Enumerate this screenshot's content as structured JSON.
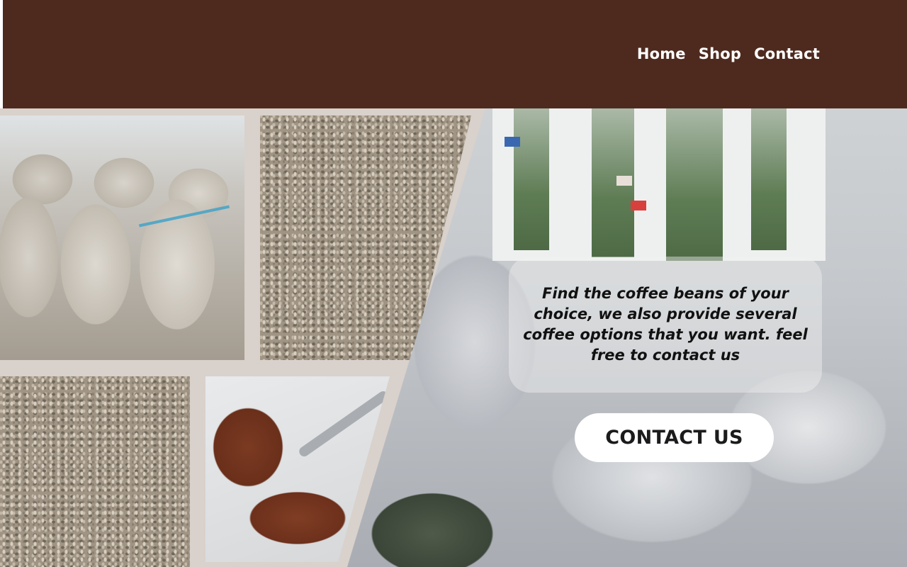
{
  "nav": {
    "home": "Home",
    "shop": "Shop",
    "contact": "Contact"
  },
  "hero": {
    "message": "Find the coffee beans of your choice, we also provide several coffee options that you want. feel free to contact us",
    "cta_label": "CONTACT US"
  },
  "colors": {
    "header_bg": "#4e2a1e",
    "page_bg": "#d9d1cb",
    "cta_bg": "#ffffff"
  }
}
